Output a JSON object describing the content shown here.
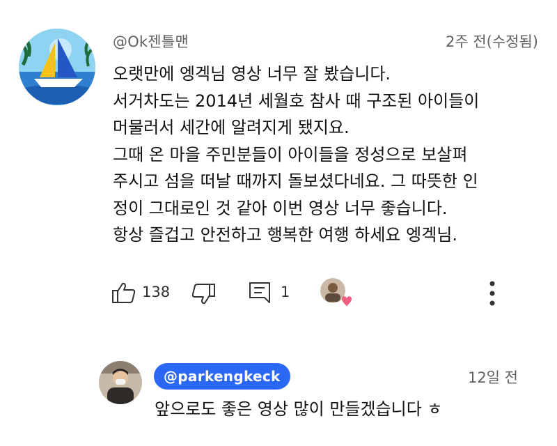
{
  "comment": {
    "author": "@Ok젠틀맨",
    "time": "2주 전(수정됨)",
    "lines": [
      "오랫만에 엥겍님 영상 너무 잘 봤습니다.",
      "서거차도는 2014년 세월호 참사 때 구조된 아이들이",
      "머물러서 세간에 알려지게 됐지요.",
      "그때 온 마을 주민분들이 아이들을 정성으로 보살펴",
      "주시고 섬을 떠날 때까지 돌보셨다네요. 그 따뜻한 인",
      "정이 그대로인 것 같아 이번 영상 너무 좋습니다.",
      "항상 즐겁고 안전하고 행복한 여행 하세요 엥겍님."
    ],
    "like_count": "138",
    "reply_count": "1",
    "icons": {
      "like": "thumbs-up-icon",
      "dislike": "thumbs-down-icon",
      "reply": "reply-icon",
      "more": "more-vert-icon",
      "creator_heart": "creator-heart-avatar"
    }
  },
  "reply": {
    "author": "@parkengkeck",
    "time": "12일 전",
    "text": "앞으로도 좋은 영상 많이 만들겠습니다 ㅎ"
  },
  "colors": {
    "author_badge_bg": "#2b67f5",
    "meta_text": "#606060",
    "heart": "#f06080"
  }
}
